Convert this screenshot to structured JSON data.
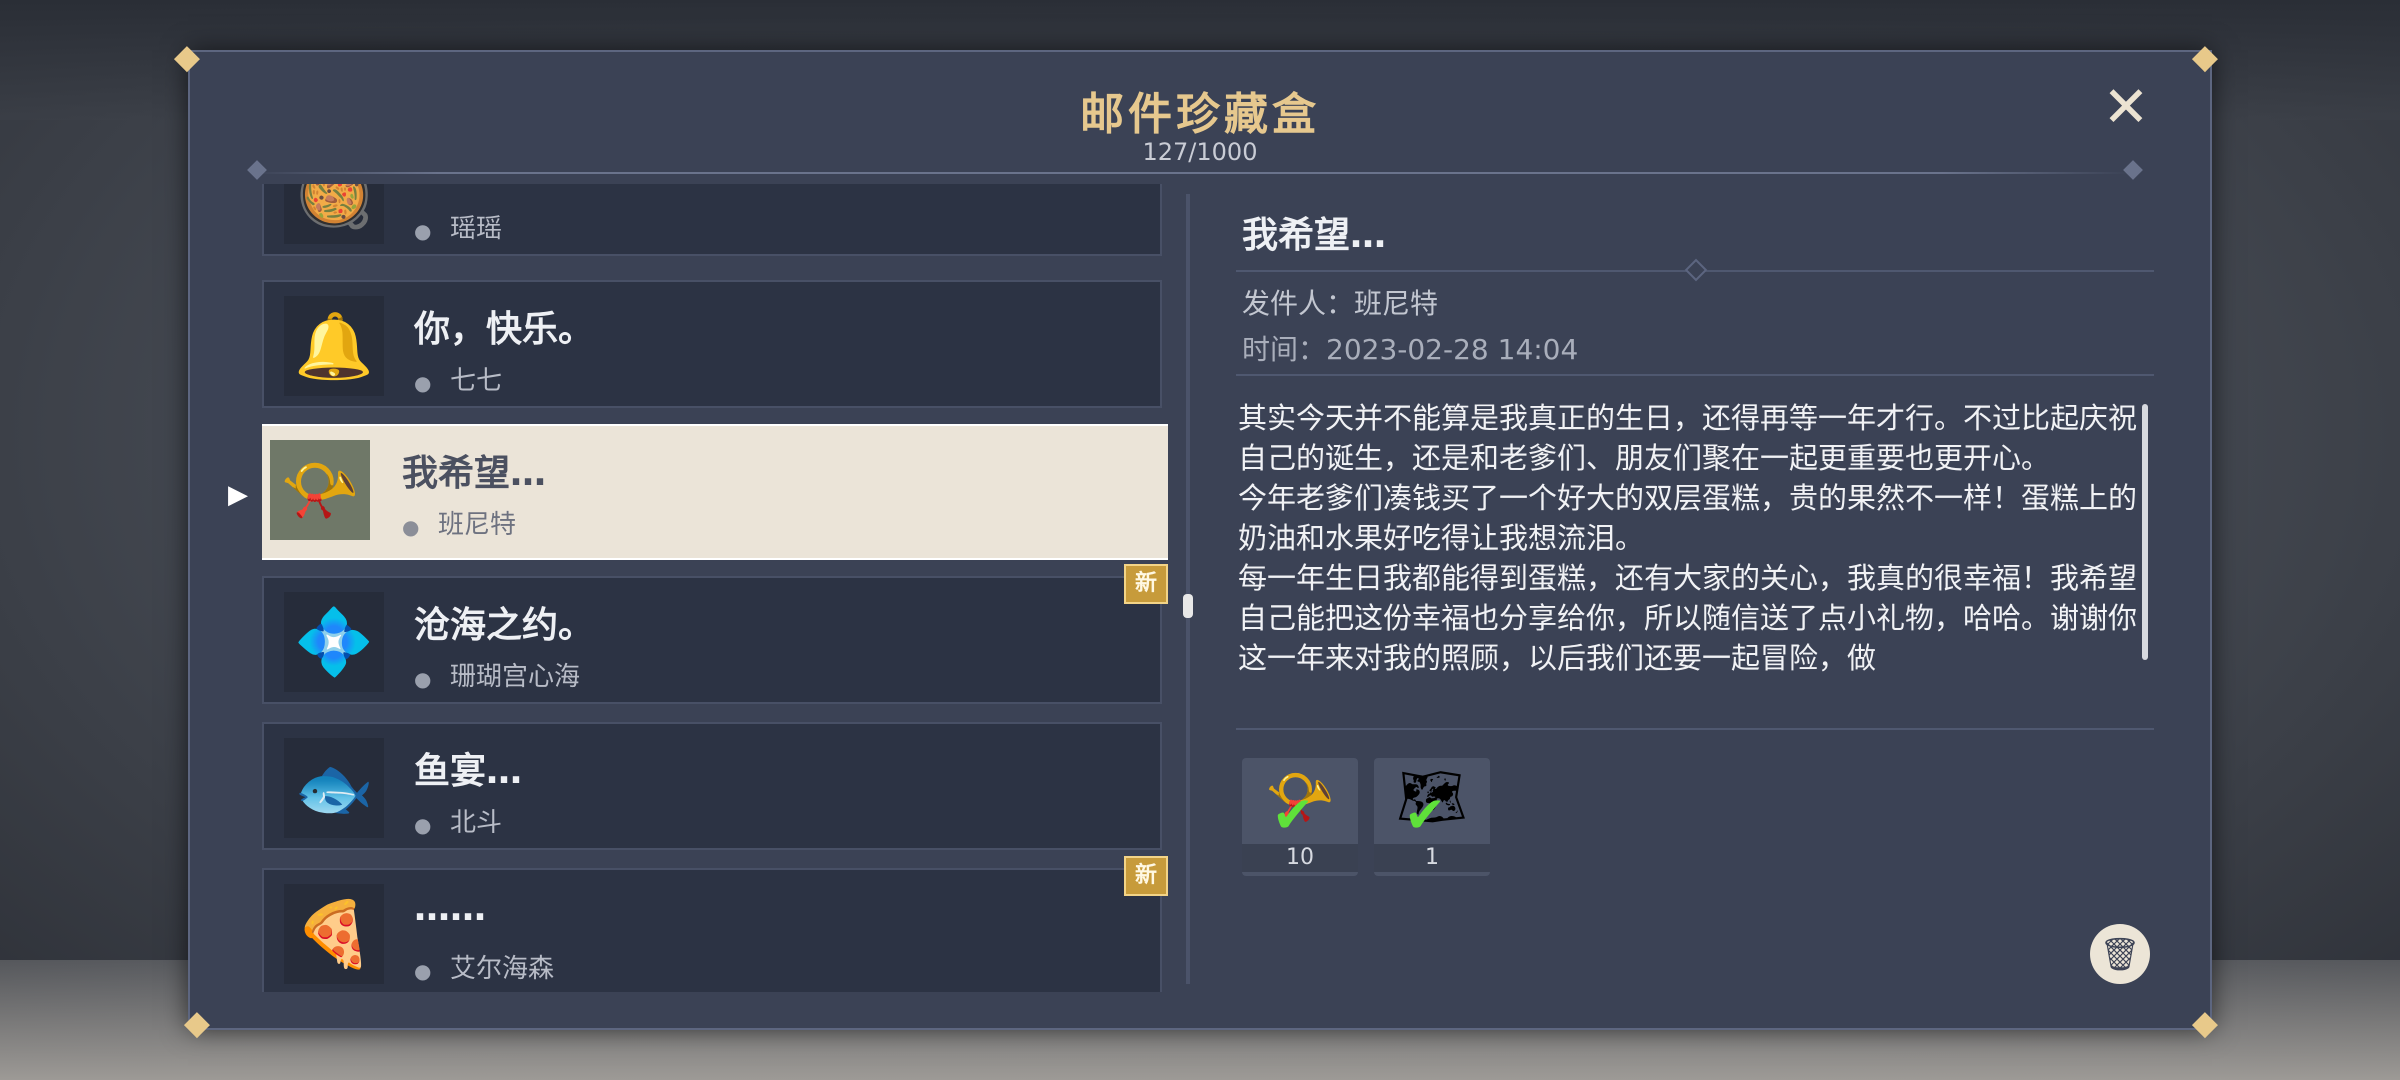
{
  "header": {
    "title": "邮件珍藏盒",
    "count": "127/1000",
    "close_icon": "close-icon"
  },
  "mail_list": {
    "items": [
      {
        "name": "",
        "sender": "瑶瑶",
        "icon": "dish-icon",
        "new": false,
        "selected": false
      },
      {
        "name": "你，快乐。",
        "sender": "七七",
        "icon": "flower-icon",
        "new": false,
        "selected": false
      },
      {
        "name": "我希望…",
        "sender": "班尼特",
        "icon": "horn-icon",
        "new": false,
        "selected": true
      },
      {
        "name": "沧海之约。",
        "sender": "珊瑚宫心海",
        "icon": "crystal-icon",
        "new": true,
        "selected": false
      },
      {
        "name": "鱼宴…",
        "sender": "北斗",
        "icon": "fish-icon",
        "new": false,
        "selected": false
      },
      {
        "name": "……",
        "sender": "艾尔海森",
        "icon": "pizza-icon",
        "new": true,
        "selected": false
      }
    ],
    "new_label": "新"
  },
  "detail": {
    "title": "我希望…",
    "from": "发件人：班尼特",
    "time": "时间：2023-02-28 14:04",
    "body": [
      "其实今天并不能算是我真正的生日，还得再等一年才行。不过比起庆祝自己的诞生，还是和老爹们、朋友们聚在一起更重要也更开心。",
      "今年老爹们凑钱买了一个好大的双层蛋糕，贵的果然不一样！蛋糕上的奶油和水果好吃得让我想流泪。",
      "每一年生日我都能得到蛋糕，还有大家的关心，我真的很幸福！我希望自己能把这份幸福也分享给你，所以随信送了点小礼物，哈哈。谢谢你这一年来对我的照顾，以后我们还要一起冒险，做"
    ],
    "attachments": [
      {
        "qty": "10",
        "icon": "horn-icon",
        "claimed": true
      },
      {
        "qty": "1",
        "icon": "map-icon",
        "claimed": true
      }
    ],
    "delete_icon": "trash-icon"
  }
}
